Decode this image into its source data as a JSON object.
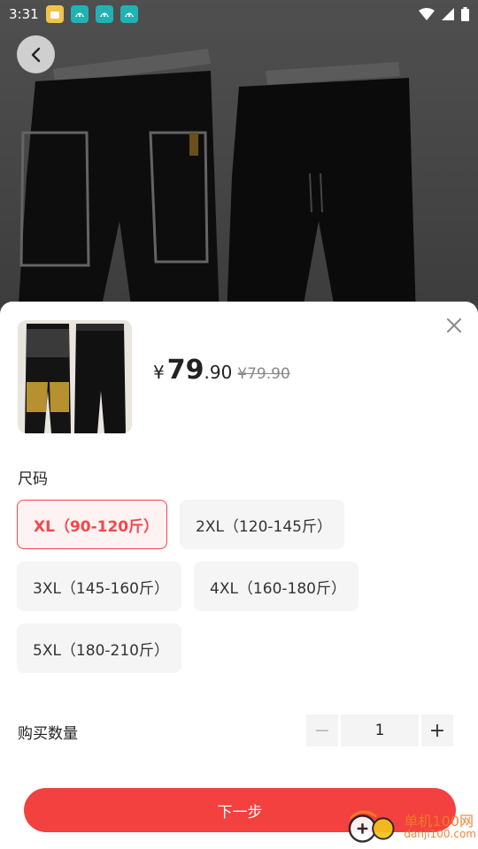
{
  "status_bar": {
    "time": "3:31",
    "notifications": [
      "app-icon",
      "teal-app-icon",
      "teal-app-icon",
      "teal-app-icon"
    ],
    "right_icons": [
      "wifi-icon",
      "signal-icon",
      "battery-icon"
    ]
  },
  "product": {
    "price_symbol": "¥",
    "price_integer": "79",
    "price_decimal": ".90",
    "original_price": "¥79.90"
  },
  "size": {
    "label": "尺码",
    "options": [
      {
        "label": "XL（90-120斤）",
        "selected": true
      },
      {
        "label": "2XL（120-145斤）",
        "selected": false
      },
      {
        "label": "3XL（145-160斤）",
        "selected": false
      },
      {
        "label": "4XL（160-180斤）",
        "selected": false
      },
      {
        "label": "5XL（180-210斤）",
        "selected": false
      }
    ]
  },
  "quantity": {
    "label": "购买数量",
    "minus": "−",
    "value": "1",
    "plus": "+"
  },
  "actions": {
    "next": "下一步"
  },
  "watermark": {
    "title": "单机100网",
    "url": "danji100.com"
  },
  "colors": {
    "accent": "#f2413f",
    "selected_border": "#f1484b"
  }
}
